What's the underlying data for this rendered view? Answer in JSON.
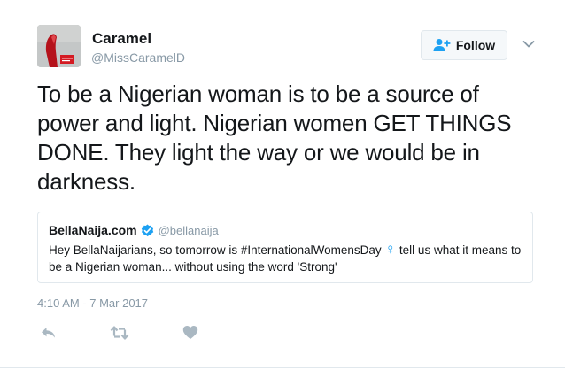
{
  "author": {
    "name": "Caramel",
    "handle": "@MissCaramelD",
    "avatar_icon": "profile-photo"
  },
  "follow_button": {
    "label": "Follow",
    "icon": "follow-person-plus-icon"
  },
  "more_menu": {
    "icon": "chevron-down-icon"
  },
  "tweet": {
    "text": "To be a Nigerian woman is to be a source of power and light. Nigerian women GET THINGS DONE. They light the way or we would be in darkness.",
    "timestamp": "4:10 AM - 7 Mar 2017"
  },
  "quoted_tweet": {
    "name": "BellaNaija.com",
    "handle": "@bellanaija",
    "verified_icon": "verified-badge-icon",
    "text_before": "Hey BellaNaijarians, so tomorrow is #InternationalWomensDay ",
    "emoji": "♀",
    "text_after": " tell us what it means to be a Nigerian woman... without using the word 'Strong'"
  },
  "actions": [
    {
      "icon": "reply-icon"
    },
    {
      "icon": "retweet-icon"
    },
    {
      "icon": "like-heart-icon"
    }
  ],
  "colors": {
    "text": "#14171a",
    "secondary": "#8899a6",
    "border": "#e1e8ed",
    "accent": "#1da1f2",
    "button_bg": "#f5f8fa"
  }
}
